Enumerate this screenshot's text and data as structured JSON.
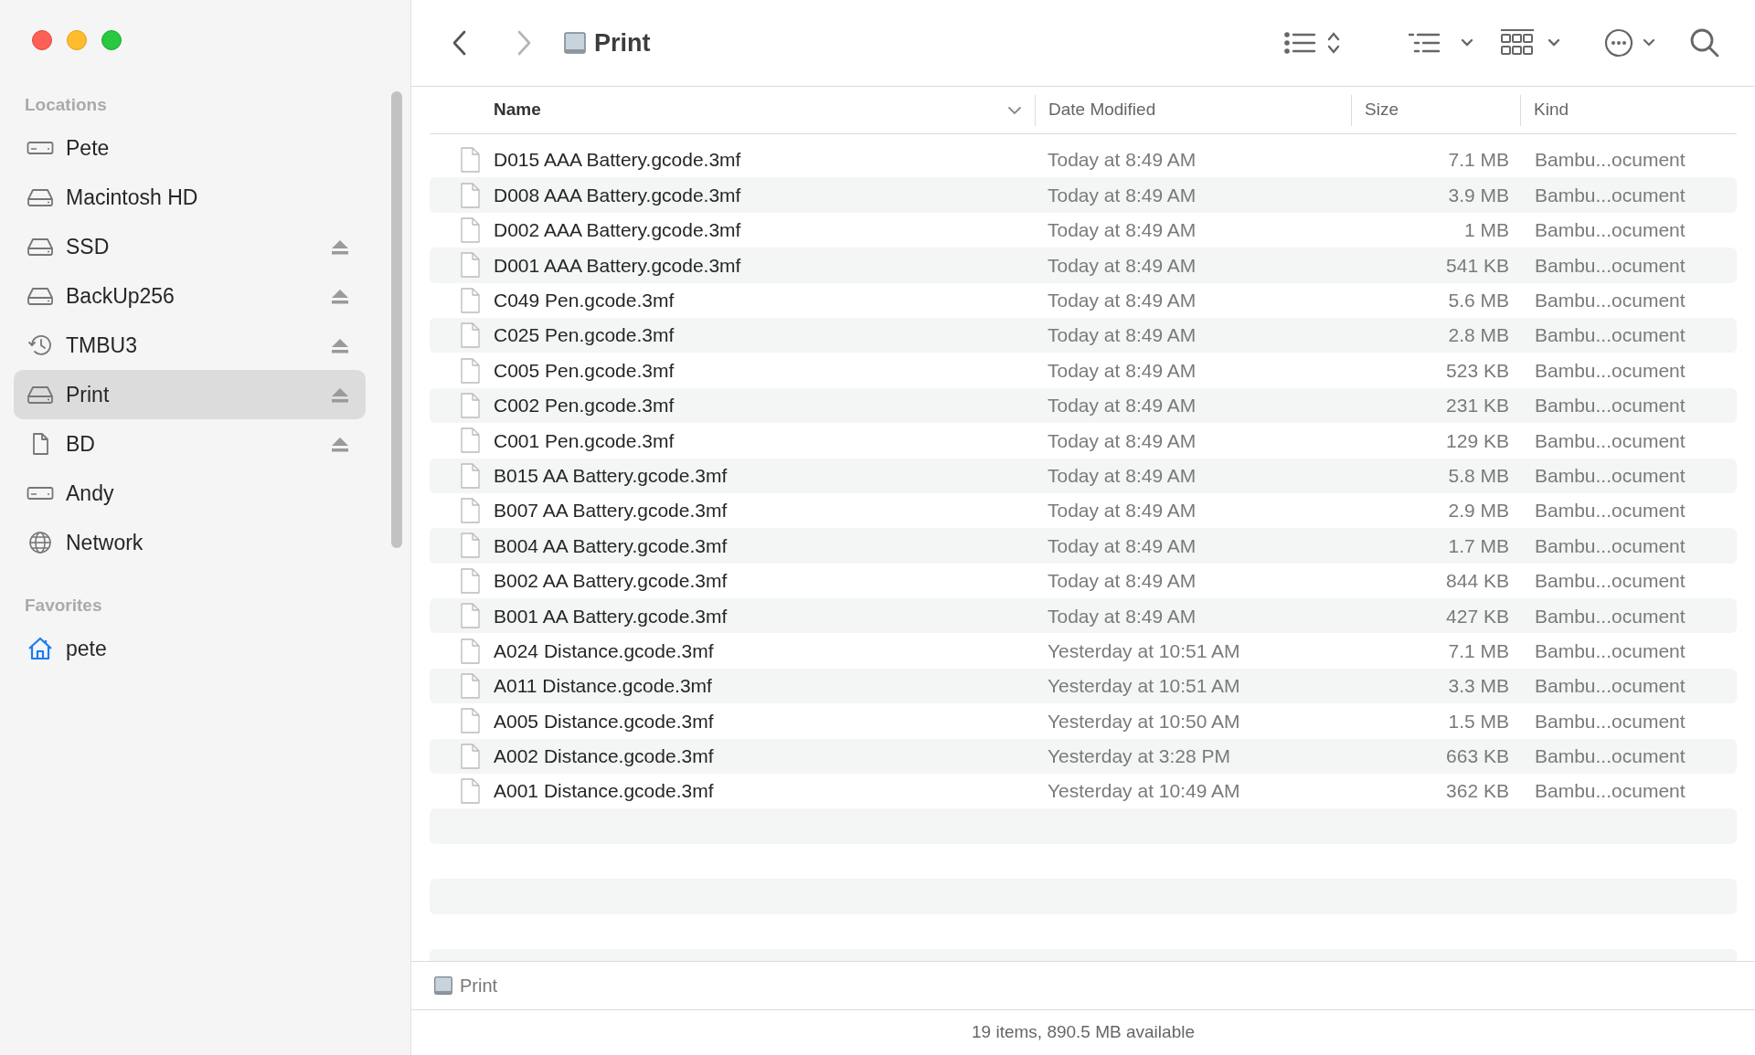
{
  "window": {
    "title": "Print"
  },
  "sidebar": {
    "sections": [
      {
        "title": "Locations",
        "items": [
          {
            "label": "Pete",
            "kind": "external",
            "eject": false,
            "selected": false
          },
          {
            "label": "Macintosh HD",
            "kind": "internal",
            "eject": false,
            "selected": false
          },
          {
            "label": "SSD",
            "kind": "internal",
            "eject": true,
            "selected": false
          },
          {
            "label": "BackUp256",
            "kind": "internal",
            "eject": true,
            "selected": false
          },
          {
            "label": "TMBU3",
            "kind": "timemachine",
            "eject": true,
            "selected": false
          },
          {
            "label": "Print",
            "kind": "internal",
            "eject": true,
            "selected": true
          },
          {
            "label": "BD",
            "kind": "file",
            "eject": true,
            "selected": false
          },
          {
            "label": "Andy",
            "kind": "external",
            "eject": false,
            "selected": false
          },
          {
            "label": "Network",
            "kind": "network",
            "eject": false,
            "selected": false
          }
        ]
      },
      {
        "title": "Favorites",
        "items": [
          {
            "label": "pete",
            "kind": "home",
            "eject": false,
            "selected": false
          }
        ]
      }
    ]
  },
  "table": {
    "columns": [
      {
        "label": "Name",
        "sorted": true
      },
      {
        "label": "Date Modified",
        "sorted": false
      },
      {
        "label": "Size",
        "sorted": false
      },
      {
        "label": "Kind",
        "sorted": false
      }
    ],
    "rows": [
      {
        "name": "D015 AAA Battery.gcode.3mf",
        "date": "Today at 8:49 AM",
        "size": "7.1 MB",
        "kind": "Bambu...ocument"
      },
      {
        "name": "D008 AAA Battery.gcode.3mf",
        "date": "Today at 8:49 AM",
        "size": "3.9 MB",
        "kind": "Bambu...ocument"
      },
      {
        "name": "D002 AAA Battery.gcode.3mf",
        "date": "Today at 8:49 AM",
        "size": "1 MB",
        "kind": "Bambu...ocument"
      },
      {
        "name": "D001 AAA Battery.gcode.3mf",
        "date": "Today at 8:49 AM",
        "size": "541 KB",
        "kind": "Bambu...ocument"
      },
      {
        "name": "C049 Pen.gcode.3mf",
        "date": "Today at 8:49 AM",
        "size": "5.6 MB",
        "kind": "Bambu...ocument"
      },
      {
        "name": "C025 Pen.gcode.3mf",
        "date": "Today at 8:49 AM",
        "size": "2.8 MB",
        "kind": "Bambu...ocument"
      },
      {
        "name": "C005 Pen.gcode.3mf",
        "date": "Today at 8:49 AM",
        "size": "523 KB",
        "kind": "Bambu...ocument"
      },
      {
        "name": "C002 Pen.gcode.3mf",
        "date": "Today at 8:49 AM",
        "size": "231 KB",
        "kind": "Bambu...ocument"
      },
      {
        "name": "C001 Pen.gcode.3mf",
        "date": "Today at 8:49 AM",
        "size": "129 KB",
        "kind": "Bambu...ocument"
      },
      {
        "name": "B015 AA Battery.gcode.3mf",
        "date": "Today at 8:49 AM",
        "size": "5.8 MB",
        "kind": "Bambu...ocument"
      },
      {
        "name": "B007 AA Battery.gcode.3mf",
        "date": "Today at 8:49 AM",
        "size": "2.9 MB",
        "kind": "Bambu...ocument"
      },
      {
        "name": "B004 AA Battery.gcode.3mf",
        "date": "Today at 8:49 AM",
        "size": "1.7 MB",
        "kind": "Bambu...ocument"
      },
      {
        "name": "B002 AA Battery.gcode.3mf",
        "date": "Today at 8:49 AM",
        "size": "844 KB",
        "kind": "Bambu...ocument"
      },
      {
        "name": "B001 AA Battery.gcode.3mf",
        "date": "Today at 8:49 AM",
        "size": "427 KB",
        "kind": "Bambu...ocument"
      },
      {
        "name": "A024 Distance.gcode.3mf",
        "date": "Yesterday at 10:51 AM",
        "size": "7.1 MB",
        "kind": "Bambu...ocument"
      },
      {
        "name": "A011 Distance.gcode.3mf",
        "date": "Yesterday at 10:51 AM",
        "size": "3.3 MB",
        "kind": "Bambu...ocument"
      },
      {
        "name": "A005 Distance.gcode.3mf",
        "date": "Yesterday at 10:50 AM",
        "size": "1.5 MB",
        "kind": "Bambu...ocument"
      },
      {
        "name": "A002 Distance.gcode.3mf",
        "date": "Yesterday at 3:28 PM",
        "size": "663 KB",
        "kind": "Bambu...ocument"
      },
      {
        "name": "A001 Distance.gcode.3mf",
        "date": "Yesterday at 10:49 AM",
        "size": "362 KB",
        "kind": "Bambu...ocument"
      }
    ]
  },
  "path_bar": {
    "label": "Print"
  },
  "status_bar": "19 items, 890.5 MB available"
}
